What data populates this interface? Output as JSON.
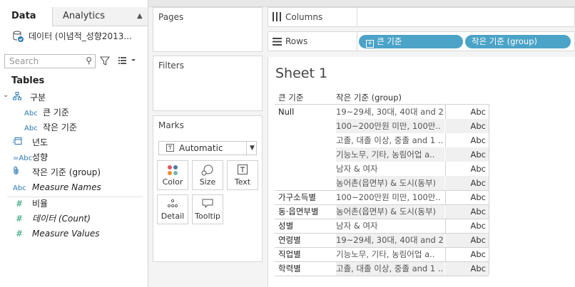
{
  "tabs": {
    "data": "Data",
    "analytics": "Analytics"
  },
  "datasource": {
    "name": "데이터 (이념적_성향2013..."
  },
  "search": {
    "placeholder": "Search"
  },
  "tables": {
    "title": "Tables",
    "dimensions": [
      {
        "icon": "hierarchy",
        "label": "구분",
        "indent": 0
      },
      {
        "icon": "Abc",
        "label": "큰 기준",
        "indent": 1
      },
      {
        "icon": "Abc",
        "label": "작은 기준",
        "indent": 1
      },
      {
        "icon": "date",
        "label": "년도",
        "indent": 0
      },
      {
        "icon": "=Abc",
        "label": "성향",
        "indent": 0
      },
      {
        "icon": "paperclip",
        "label": "작은 기준 (group)",
        "indent": 0
      },
      {
        "icon": "Abc",
        "label": "Measure Names",
        "indent": 0,
        "italic": true
      }
    ],
    "measures": [
      {
        "icon": "#",
        "label": "비율"
      },
      {
        "icon": "#",
        "label": "데이터 (Count)",
        "italic": true
      },
      {
        "icon": "#",
        "label": "Measure Values",
        "italic": true
      }
    ]
  },
  "cards": {
    "pages": "Pages",
    "filters": "Filters",
    "marks": "Marks"
  },
  "marks": {
    "type": "Automatic",
    "buttons": [
      {
        "icon": "color",
        "label": "Color"
      },
      {
        "icon": "size",
        "label": "Size"
      },
      {
        "icon": "text",
        "label": "Text"
      },
      {
        "icon": "detail",
        "label": "Detail"
      },
      {
        "icon": "tooltip",
        "label": "Tooltip"
      }
    ]
  },
  "shelves": {
    "columns": "Columns",
    "rows": "Rows",
    "row_pills": [
      "큰 기준",
      "작은 기준 (group)"
    ]
  },
  "sheet": {
    "title": "Sheet 1",
    "col_headers": [
      "큰 기준",
      "작은 기준 (group)"
    ],
    "rows": [
      {
        "c1": "Null",
        "c2": "19~29세, 30대, 40대 and 2..",
        "c3": "Abc"
      },
      {
        "c1": "",
        "c2": "100~200만원 미만, 100만..",
        "c3": "Abc"
      },
      {
        "c1": "",
        "c2": "고졸, 대졸 이상, 중졸 and 1 ..",
        "c3": "Abc"
      },
      {
        "c1": "",
        "c2": "기능노무, 기타, 농림어업 a..",
        "c3": "Abc"
      },
      {
        "c1": "",
        "c2": "남자 & 여자",
        "c3": "Abc"
      },
      {
        "c1": "",
        "c2": "농어촌(읍면부) & 도시(동부)",
        "c3": "Abc"
      },
      {
        "c1": "가구소득별",
        "c2": "100~200만원 미만, 100만..",
        "c3": "Abc"
      },
      {
        "c1": "동·읍면부별",
        "c2": "농어촌(읍면부) & 도시(동부)",
        "c3": "Abc"
      },
      {
        "c1": "성별",
        "c2": "남자 & 여자",
        "c3": "Abc"
      },
      {
        "c1": "연령별",
        "c2": "19~29세, 30대, 40대 and 2..",
        "c3": "Abc"
      },
      {
        "c1": "직업별",
        "c2": "기능노무, 기타, 농림어업 a..",
        "c3": "Abc"
      },
      {
        "c1": "학력별",
        "c2": "고졸, 대졸 이상, 중졸 and 1 ..",
        "c3": "Abc"
      }
    ]
  },
  "colors": {
    "pill": "#4ba3c7",
    "field_icon": "#2a7ab0",
    "measure_icon": "#2e9e7a"
  }
}
